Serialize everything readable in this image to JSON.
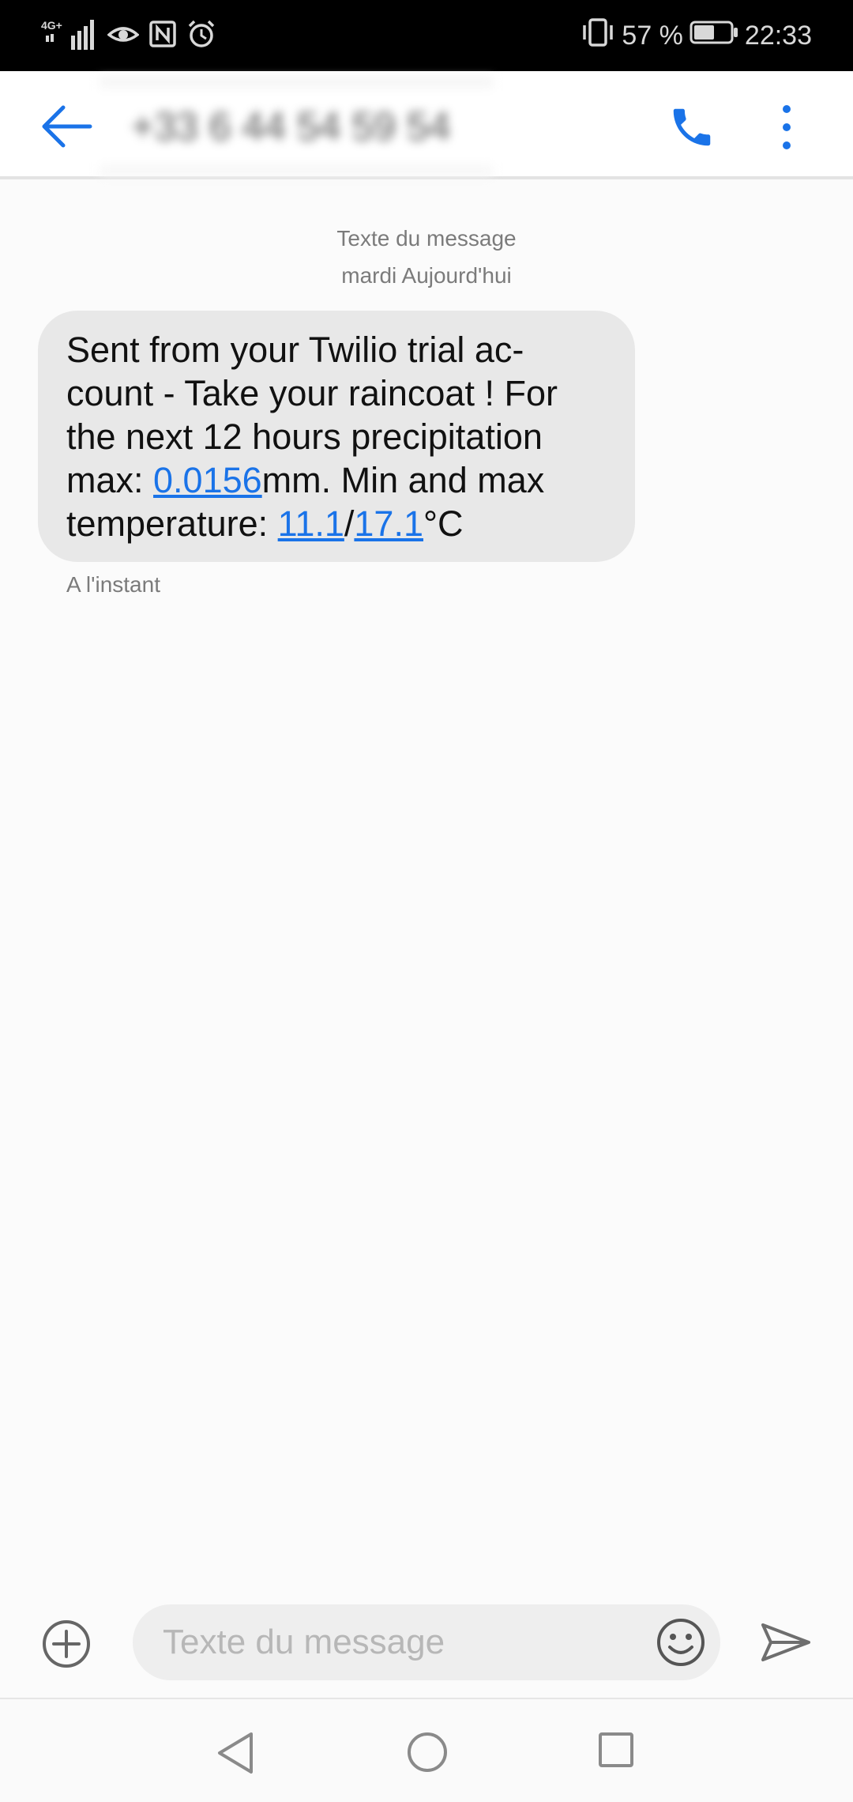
{
  "status_bar": {
    "network": "4G+",
    "battery_percent": "57 %",
    "battery_level": 0.57,
    "time": "22:33"
  },
  "app_bar": {
    "contact": "+33 6 44 54 59 54",
    "icons": [
      "arrow-left-icon",
      "phone-icon",
      "more-vert-icon"
    ]
  },
  "conversation": {
    "channel_label": "Texte du message",
    "date_label": "mardi Aujourd'hui",
    "messages": [
      {
        "text_part_1": "Sent from your Twilio trial ac-count - Take your raincoat ! For the next 12 hours precipitation max: ",
        "link_precip": "0.0156",
        "text_part_2": "mm. Min and max temperature: ",
        "link_min_temp": "11.1",
        "separator": "/",
        "link_max_temp": "17.1",
        "text_part_3": "°C",
        "timestamp": "A l'instant"
      }
    ]
  },
  "composer": {
    "placeholder": "Texte du message",
    "value": "",
    "icons": [
      "add-circle-icon",
      "emoji-icon",
      "send-icon"
    ]
  },
  "nav_bar": {
    "icons": [
      "nav-back-icon",
      "nav-home-icon",
      "nav-recents-icon"
    ]
  },
  "colors": {
    "accent": "#1a73e8",
    "bubble": "#e8e8e8",
    "background": "#fbfbfb",
    "status_bar": "#000000"
  }
}
